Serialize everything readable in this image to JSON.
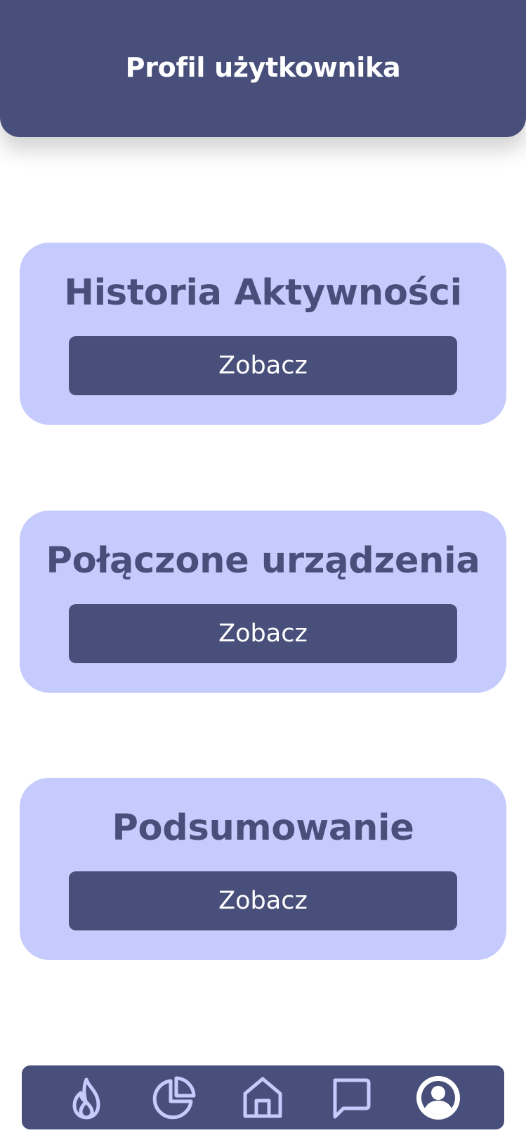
{
  "header": {
    "title": "Profil użytkownika"
  },
  "cards": [
    {
      "title": "Historia Aktywności",
      "button_label": "Zobacz"
    },
    {
      "title": "Połączone urządzenia",
      "button_label": "Zobacz"
    },
    {
      "title": "Podsumowanie",
      "button_label": "Zobacz"
    }
  ],
  "bottom_nav": {
    "items": [
      {
        "icon": "flame-icon"
      },
      {
        "icon": "pie-chart-icon"
      },
      {
        "icon": "home-icon"
      },
      {
        "icon": "chat-icon"
      },
      {
        "icon": "user-profile-icon",
        "active": true
      }
    ]
  },
  "colors": {
    "primary": "#484f7a",
    "card_background": "#c6cbfd",
    "text_on_primary": "#ffffff",
    "icon": "#c6cbfd"
  }
}
